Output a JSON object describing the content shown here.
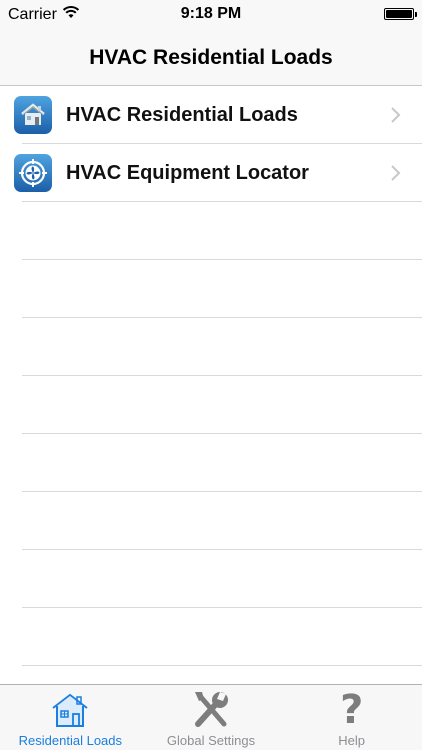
{
  "status_bar": {
    "carrier": "Carrier",
    "time": "9:18 PM",
    "wifi_icon": "wifi-icon",
    "battery_level": 1.0
  },
  "nav": {
    "title": "HVAC Residential Loads"
  },
  "list": {
    "items": [
      {
        "label": "HVAC Residential Loads",
        "icon": "house-icon"
      },
      {
        "label": "HVAC Equipment Locator",
        "icon": "fan-target-icon"
      }
    ]
  },
  "tab_bar": {
    "tabs": [
      {
        "label": "Residential Loads",
        "icon": "house-outline-icon",
        "active": true
      },
      {
        "label": "Global Settings",
        "icon": "tools-icon",
        "active": false
      },
      {
        "label": "Help",
        "icon": "question-mark-icon",
        "active": false
      }
    ],
    "help_glyph": "?"
  },
  "colors": {
    "accent": "#1a7fe0",
    "inactive_tab": "#8e8e93",
    "separator": "#d9d9dd",
    "bar_background": "#f8f8f8"
  }
}
